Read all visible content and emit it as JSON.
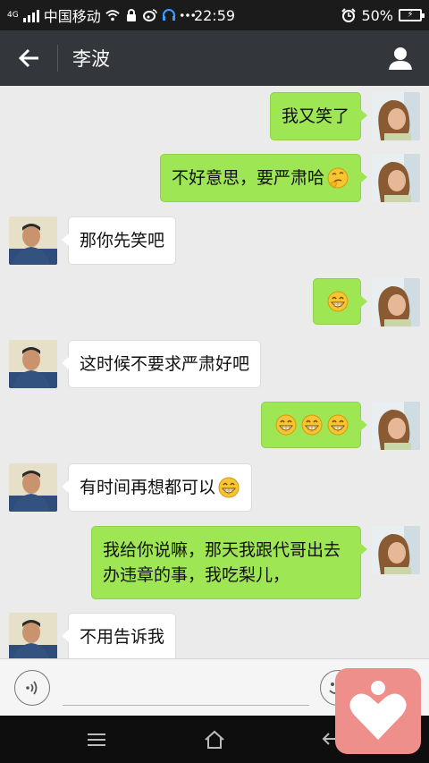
{
  "status_bar": {
    "network_type": "4G",
    "carrier": "中国移动",
    "time": "22:59",
    "battery": "50%"
  },
  "header": {
    "title": "李波",
    "back_icon": "arrow-left-icon",
    "profile_icon": "person-icon"
  },
  "messages": [
    {
      "side": "right",
      "text": "我又笑了",
      "emoji": []
    },
    {
      "side": "right",
      "text": "不好意思，要严肃哈",
      "emoji": [
        "thinking-face"
      ]
    },
    {
      "side": "left",
      "text": "那你先笑吧",
      "emoji": []
    },
    {
      "side": "right",
      "text": "",
      "emoji": [
        "grinning-face"
      ]
    },
    {
      "side": "left",
      "text": "这时候不要求严肃好吧",
      "emoji": []
    },
    {
      "side": "right",
      "text": "",
      "emoji": [
        "grinning-face",
        "grinning-face",
        "grinning-face"
      ]
    },
    {
      "side": "left",
      "text": "有时间再想都可以",
      "emoji": [
        "grinning-face"
      ]
    },
    {
      "side": "right",
      "text": "我给你说嘛，那天我跟代哥出去办违章的事，我吃梨儿，",
      "emoji": []
    },
    {
      "side": "left",
      "text": "不用告诉我",
      "emoji": []
    }
  ],
  "input_bar": {
    "voice_icon": "voice-icon",
    "emoji_icon": "smiley-icon",
    "text_value": ""
  },
  "nav_bar": {
    "icons": [
      "menu-icon",
      "home-icon",
      "back-icon"
    ]
  },
  "colors": {
    "title_bar": "#33363b",
    "sent_bubble": "#9ee654",
    "received_bubble": "#ffffff",
    "chat_background": "#ebebeb",
    "floating_app": "#ef8f8b"
  }
}
